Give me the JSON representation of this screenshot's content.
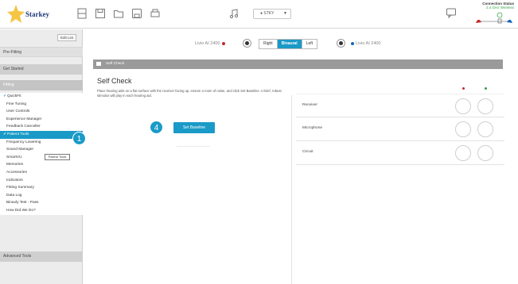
{
  "app": {
    "brand_name": "Starkey"
  },
  "toolbar": {
    "icons": [
      "people-icon",
      "save-icon",
      "folder-icon",
      "disk-icon",
      "print-icon"
    ],
    "program_select_value": "● STKY",
    "connection_status_title": "Connection Status",
    "connection_status_sub": "2.4 GHz Wireless"
  },
  "sidebar": {
    "edit_list_label": "Edit List",
    "sections": {
      "prefitting": "Pre-Fitting",
      "get_started": "Get Started",
      "fitting": "Fitting",
      "advanced": "Advanced Tools"
    },
    "items": [
      {
        "label": "QuickFit",
        "checked": true,
        "active": false
      },
      {
        "label": "Fine Tuning",
        "checked": false,
        "active": false
      },
      {
        "label": "User Controls",
        "checked": false,
        "active": false
      },
      {
        "label": "Experience Manager",
        "checked": false,
        "active": false
      },
      {
        "label": "Feedback Canceller",
        "checked": false,
        "active": false
      },
      {
        "label": "Patient Tools",
        "checked": true,
        "active": true
      },
      {
        "label": "Frequency Lowering",
        "checked": false,
        "active": false
      },
      {
        "label": "Sound Manager",
        "checked": false,
        "active": false
      },
      {
        "label": "SmartVU",
        "checked": false,
        "active": false
      },
      {
        "label": "Memories",
        "checked": false,
        "active": false
      },
      {
        "label": "Accessories",
        "checked": false,
        "active": false
      },
      {
        "label": "Indicators",
        "checked": false,
        "active": false
      },
      {
        "label": "Fitting Summary",
        "checked": false,
        "active": false
      },
      {
        "label": "Data Log",
        "checked": false,
        "active": false
      },
      {
        "label": "Binaxly Test - Pass",
        "checked": false,
        "active": false
      },
      {
        "label": "How Did We Do?",
        "checked": false,
        "active": false
      }
    ],
    "tooltip": "Patient Tools"
  },
  "badges": {
    "sidebar_step": "1",
    "button_step": "4"
  },
  "side_selector": {
    "left_device": "Livio AI 2400",
    "right_device": "Livio AI 2400",
    "options": [
      "Right",
      "Binaural",
      "Left"
    ],
    "selected": "Binaural"
  },
  "panel": {
    "header": "Self Check",
    "title": "Self Check",
    "description": "Place hearing aids on a flat surface with the receiver facing up, ensure a room of noise, and click Set Baseline. A brief, robust stimulus will play in each hearing aid.",
    "set_baseline_label": "Set Baseline",
    "checks": [
      {
        "label": "Receiver"
      },
      {
        "label": "Microphone"
      },
      {
        "label": "Circuit"
      }
    ]
  },
  "colors": {
    "accent": "#1a9ac7",
    "left_ear": "#1565c0",
    "right_ear": "#c62828",
    "status_green": "#2e9e4a"
  }
}
